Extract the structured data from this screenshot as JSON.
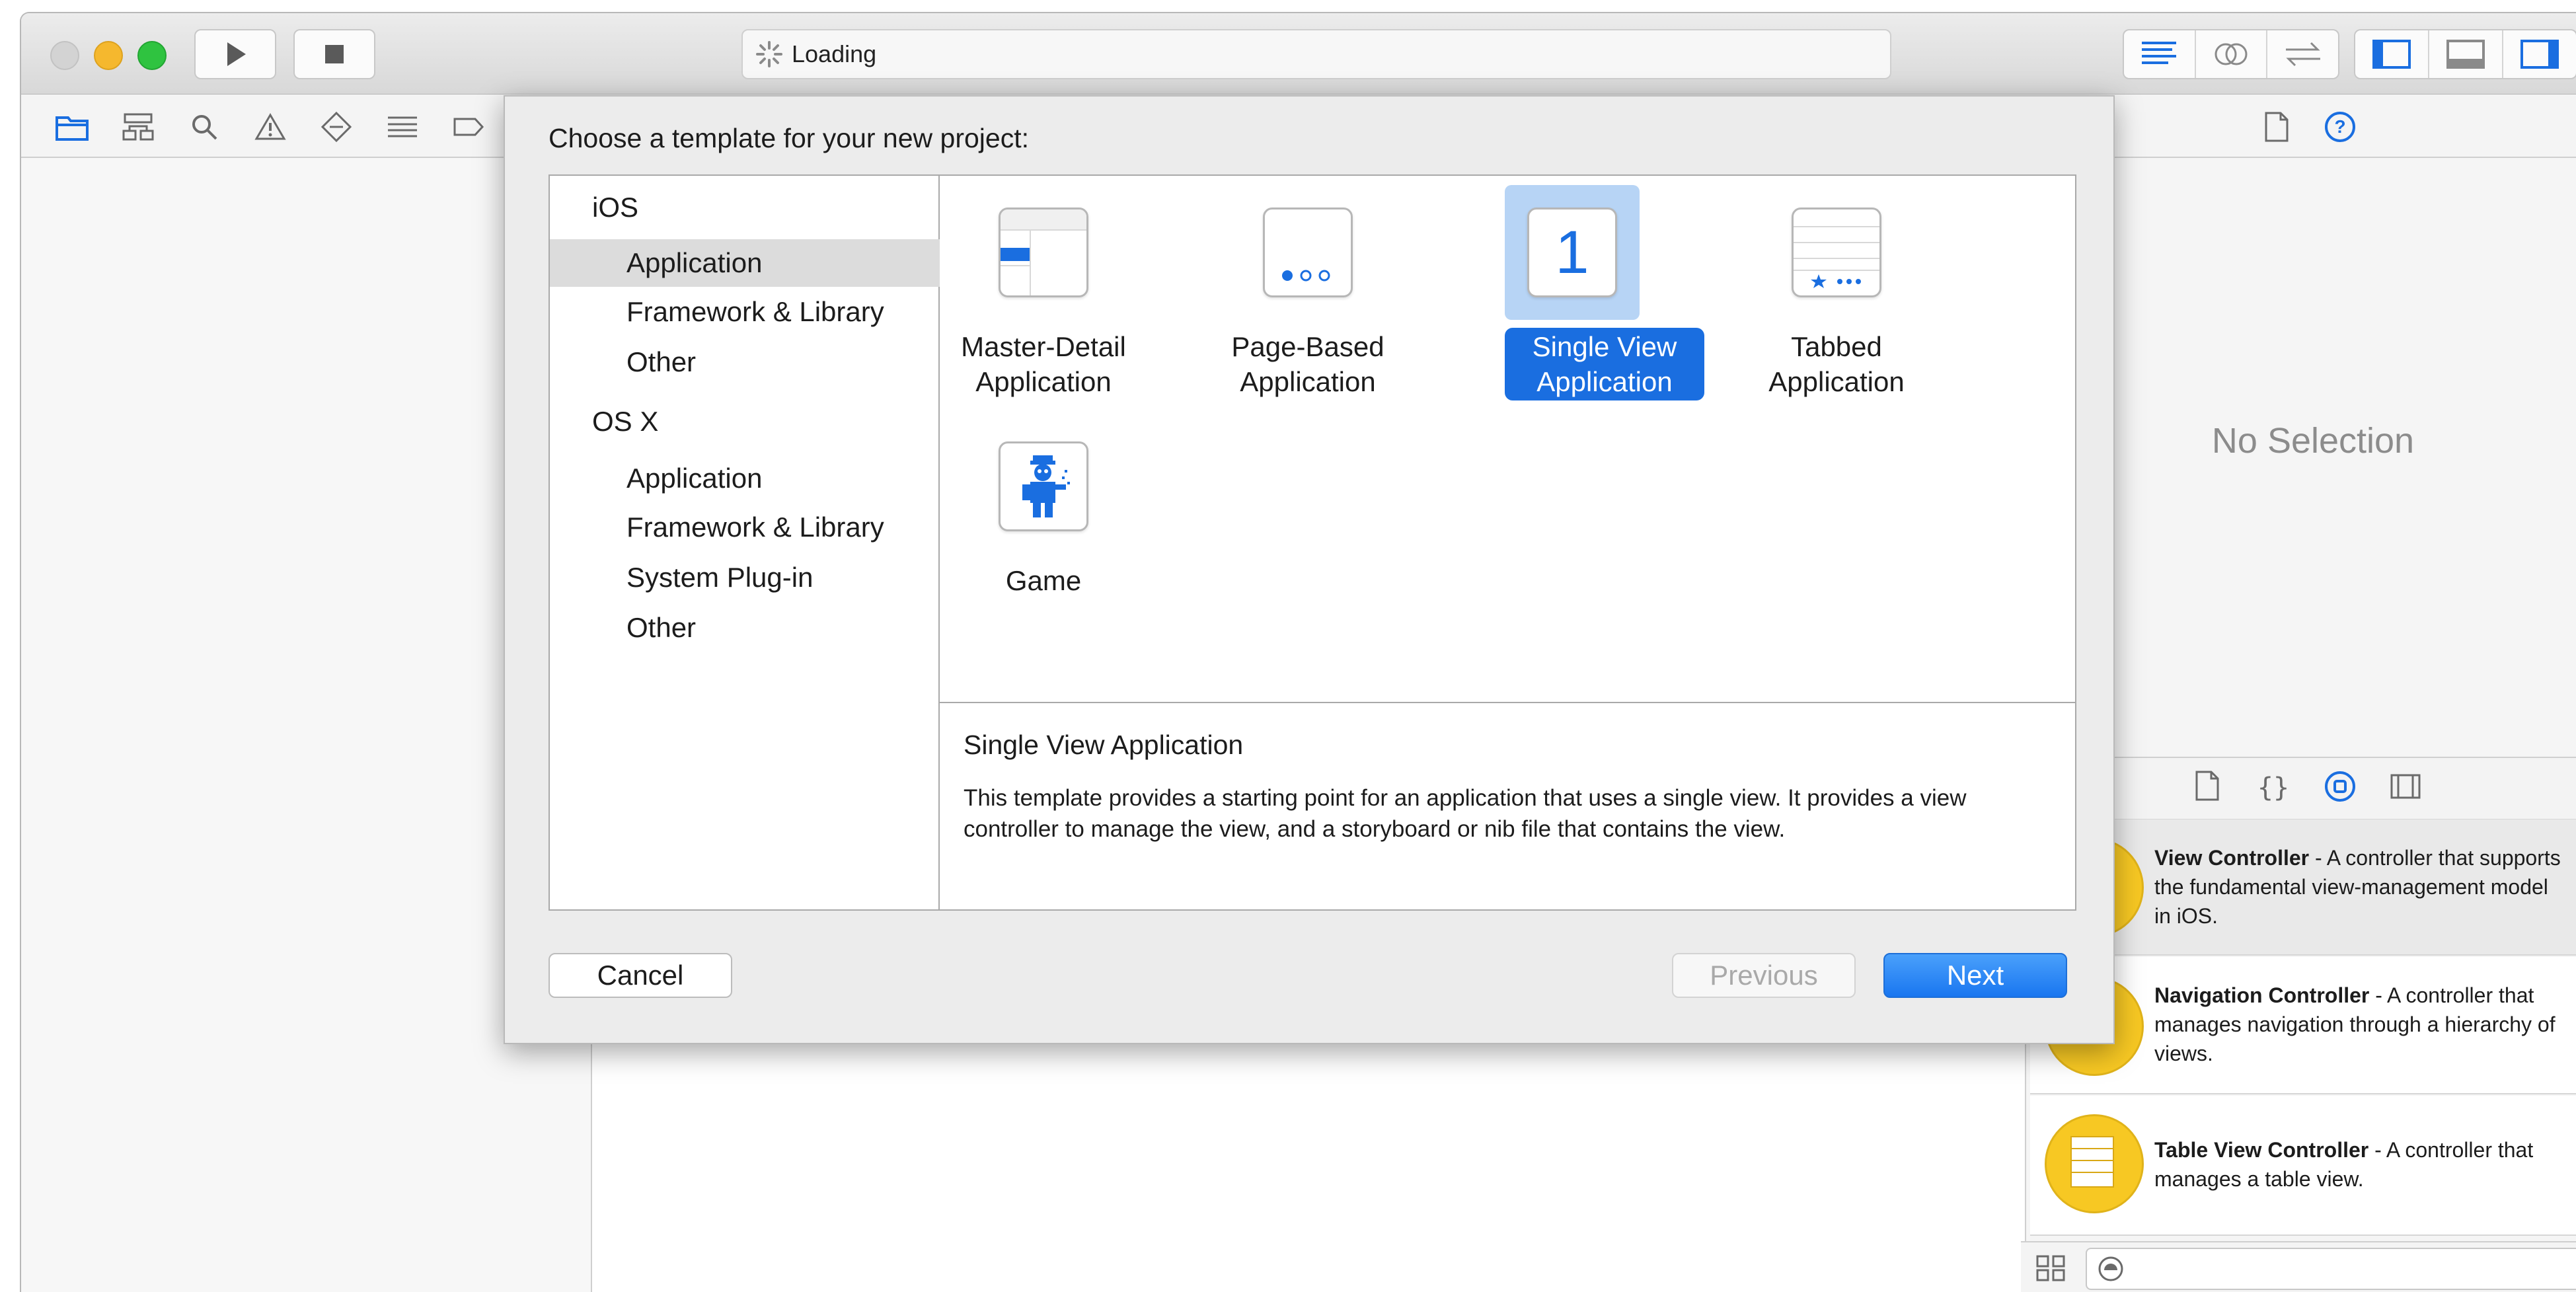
{
  "toolbar": {
    "activity_text": "Loading",
    "traffic_colors": {
      "close": "#d3d3d3",
      "minimize": "#f5b82e",
      "zoom": "#2fc340"
    }
  },
  "navigator": {
    "icons": [
      "folder-icon",
      "hierarchy-icon",
      "search-icon",
      "warning-icon",
      "test-diamond-icon",
      "debug-list-icon",
      "breakpoint-icon"
    ]
  },
  "inspector": {
    "no_selection": "No Selection"
  },
  "sheet": {
    "title": "Choose a template for your new project:",
    "categories": [
      {
        "label": "iOS",
        "kind": "platform"
      },
      {
        "label": "Application",
        "kind": "sub",
        "selected": true
      },
      {
        "label": "Framework & Library",
        "kind": "sub"
      },
      {
        "label": "Other",
        "kind": "sub"
      },
      {
        "label": "OS X",
        "kind": "platform"
      },
      {
        "label": "Application",
        "kind": "sub"
      },
      {
        "label": "Framework & Library",
        "kind": "sub"
      },
      {
        "label": "System Plug-in",
        "kind": "sub"
      },
      {
        "label": "Other",
        "kind": "sub"
      }
    ],
    "templates": [
      {
        "line1": "Master-Detail",
        "line2": "Application",
        "icon": "master-detail-icon"
      },
      {
        "line1": "Page-Based",
        "line2": "Application",
        "icon": "page-based-icon"
      },
      {
        "line1": "Single View",
        "line2": "Application",
        "icon": "single-view-icon",
        "icon_glyph": "1",
        "selected": true
      },
      {
        "line1": "Tabbed",
        "line2": "Application",
        "icon": "tabbed-icon"
      },
      {
        "line1": "Game",
        "line2": "",
        "icon": "game-icon"
      }
    ],
    "description": {
      "title": "Single View Application",
      "body": "This template provides a starting point for an application that uses a single view. It provides a view controller to manage the view, and a storyboard or nib file that contains the view."
    },
    "buttons": {
      "cancel": "Cancel",
      "previous": "Previous",
      "next": "Next"
    }
  },
  "library": {
    "items": [
      {
        "name": "View Controller",
        "desc": " - A controller that supports the fundamental view-management model in iOS."
      },
      {
        "name": "Navigation Controller",
        "desc": " - A controller that manages navigation through a hierarchy of views."
      },
      {
        "name": "Table View Controller",
        "desc": " - A controller that manages a table view."
      }
    ]
  },
  "colors": {
    "accent": "#1a6ee0",
    "selection_highlight": "#b7d4f5",
    "library_object": "#f7c823"
  }
}
